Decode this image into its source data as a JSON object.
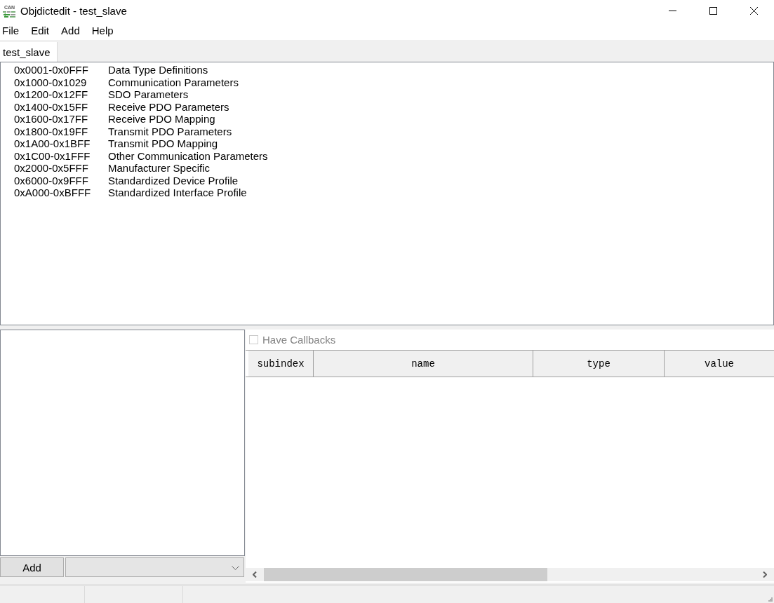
{
  "window": {
    "title": "Objdictedit - test_slave",
    "logo_text": "CAN"
  },
  "menu": [
    "File",
    "Edit",
    "Add",
    "Help"
  ],
  "tabs": [
    {
      "label": "test_slave",
      "selected": true
    }
  ],
  "index_list": [
    {
      "range": "0x0001-0x0FFF",
      "name": "Data Type Definitions"
    },
    {
      "range": "0x1000-0x1029",
      "name": "Communication Parameters"
    },
    {
      "range": "0x1200-0x12FF",
      "name": "SDO Parameters"
    },
    {
      "range": "0x1400-0x15FF",
      "name": "Receive PDO Parameters"
    },
    {
      "range": "0x1600-0x17FF",
      "name": "Receive PDO Mapping"
    },
    {
      "range": "0x1800-0x19FF",
      "name": "Transmit PDO Parameters"
    },
    {
      "range": "0x1A00-0x1BFF",
      "name": "Transmit PDO Mapping"
    },
    {
      "range": "0x1C00-0x1FFF",
      "name": "Other Communication Parameters"
    },
    {
      "range": "0x2000-0x5FFF",
      "name": "Manufacturer Specific"
    },
    {
      "range": "0x6000-0x9FFF",
      "name": "Standardized Device Profile"
    },
    {
      "range": "0xA000-0xBFFF",
      "name": "Standardized Interface Profile"
    }
  ],
  "index_panel": {
    "add_button": "Add"
  },
  "subindex_panel": {
    "have_callbacks": {
      "label": "Have Callbacks",
      "checked": false,
      "disabled": true
    },
    "columns": [
      "subindex",
      "name",
      "type",
      "value"
    ]
  }
}
